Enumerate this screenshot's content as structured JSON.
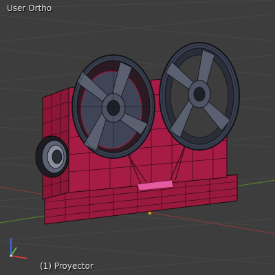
{
  "viewport": {
    "view_name": "User Ortho",
    "active_object": "(1) Proyector"
  },
  "colors": {
    "background": "#3d3d3d",
    "grid_line": "#474747",
    "x_axis": "#8a3a3a",
    "y_axis": "#5d8a2c",
    "mesh_body": "#a01a40",
    "mesh_wire": "#1a0a0e",
    "reel": "#3f4556",
    "reel_wire": "#10131a",
    "selection": "#e65aa0",
    "origin": "#e09a2a"
  },
  "icons": {
    "axis_gizmo": "xyz-axis-gizmo-icon"
  }
}
